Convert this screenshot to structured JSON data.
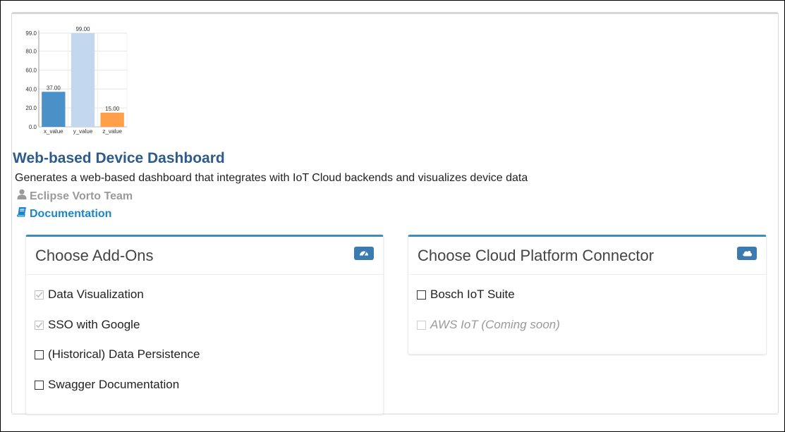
{
  "chart_data": {
    "type": "bar",
    "categories": [
      "x_value",
      "y_value",
      "z_value"
    ],
    "values": [
      37.0,
      99.0,
      15.0
    ],
    "value_labels": [
      "37.00",
      "99.00",
      "15.00"
    ],
    "y_ticks": [
      "0.0",
      "20.0",
      "40.0",
      "60.0",
      "80.0",
      "99.0"
    ],
    "ylim": [
      0,
      99
    ],
    "colors": [
      "#4a90c9",
      "#c3d7ef",
      "#ff9f4a"
    ],
    "grid": true
  },
  "app": {
    "title": "Web-based Device Dashboard",
    "description": "Generates a web-based dashboard that integrates with IoT Cloud backends and visualizes device data",
    "author": "Eclipse Vorto Team",
    "author_icon": "user-icon",
    "doc_label": "Documentation",
    "doc_icon": "book-icon"
  },
  "addons_panel": {
    "title": "Choose Add-Ons",
    "tool_icon": "dashboard-icon",
    "accent": "#3c8dbc",
    "options": [
      {
        "label": "Data Visualization",
        "checked": true,
        "disabled": true
      },
      {
        "label": "SSO with Google",
        "checked": true,
        "disabled": true
      },
      {
        "label": "(Historical) Data Persistence",
        "checked": false,
        "disabled": false
      },
      {
        "label": "Swagger Documentation",
        "checked": false,
        "disabled": false
      }
    ]
  },
  "cloud_panel": {
    "title": "Choose Cloud Platform Connector",
    "tool_icon": "cloud-icon",
    "accent": "#3c8dbc",
    "options": [
      {
        "label": "Bosch IoT Suite",
        "checked": false,
        "disabled": false
      },
      {
        "label": "AWS IoT (Coming soon)",
        "checked": false,
        "disabled": true
      }
    ]
  }
}
